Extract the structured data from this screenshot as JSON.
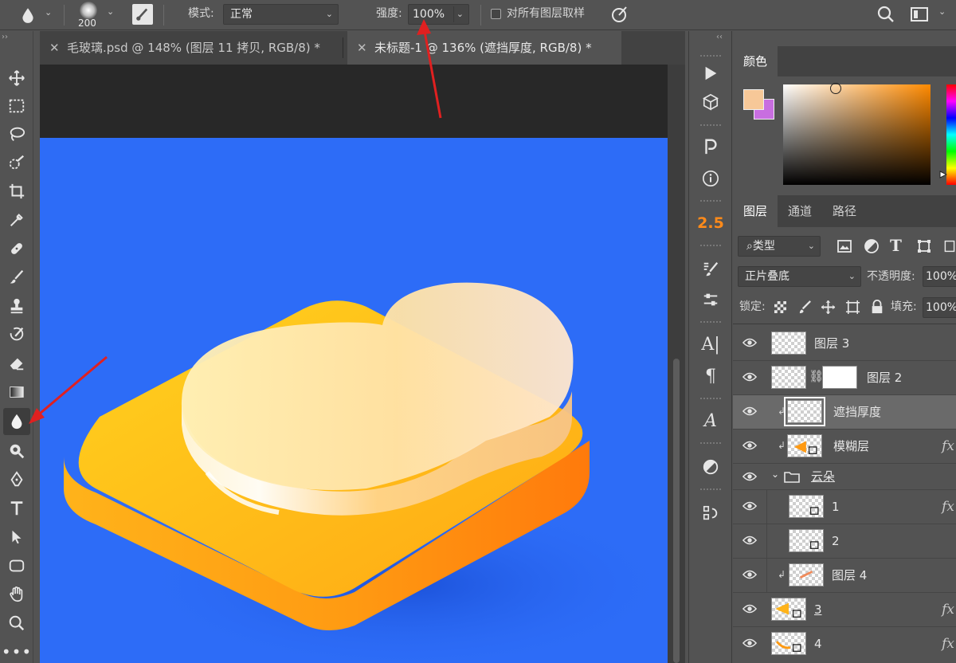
{
  "options_bar": {
    "brush_size": "200",
    "mode_label": "模式:",
    "mode_value": "正常",
    "strength_label": "强度:",
    "strength_value": "100%",
    "sample_all_label": "对所有图层取样"
  },
  "tabs": [
    {
      "label": "毛玻璃.psd @ 148% (图层 11 拷贝, RGB/8) *"
    },
    {
      "label": "未标题-1 @ 136% (遮挡厚度, RGB/8) *"
    }
  ],
  "dock": {
    "value_25": "2.5"
  },
  "color_panel": {
    "tab": "颜色",
    "foreground": "#f7c898",
    "background": "#c86ee0"
  },
  "layers_panel": {
    "tabs": [
      "图层",
      "通道",
      "路径"
    ],
    "filter_label": "类型",
    "blend_mode": "正片叠底",
    "opacity_label": "不透明度:",
    "opacity_value": "100%",
    "lock_label": "锁定:",
    "fill_label": "填充:",
    "fill_value": "100%",
    "layers": [
      {
        "name": "图层 3"
      },
      {
        "name": "图层 2"
      },
      {
        "name": "遮挡厚度"
      },
      {
        "name": "模糊层",
        "fx": "fx"
      },
      {
        "name": "云朵"
      },
      {
        "name": "1",
        "fx": "fx"
      },
      {
        "name": "2"
      },
      {
        "name": "图层 4"
      },
      {
        "name": "3",
        "fx": "fx"
      },
      {
        "name": "4",
        "fx": "fx"
      }
    ]
  },
  "colors": {
    "artboard": "#2d6cf7",
    "accent_yellow": "#ffc61a",
    "accent_orange": "#ff8a10",
    "annotation_arrow": "#e02020"
  }
}
